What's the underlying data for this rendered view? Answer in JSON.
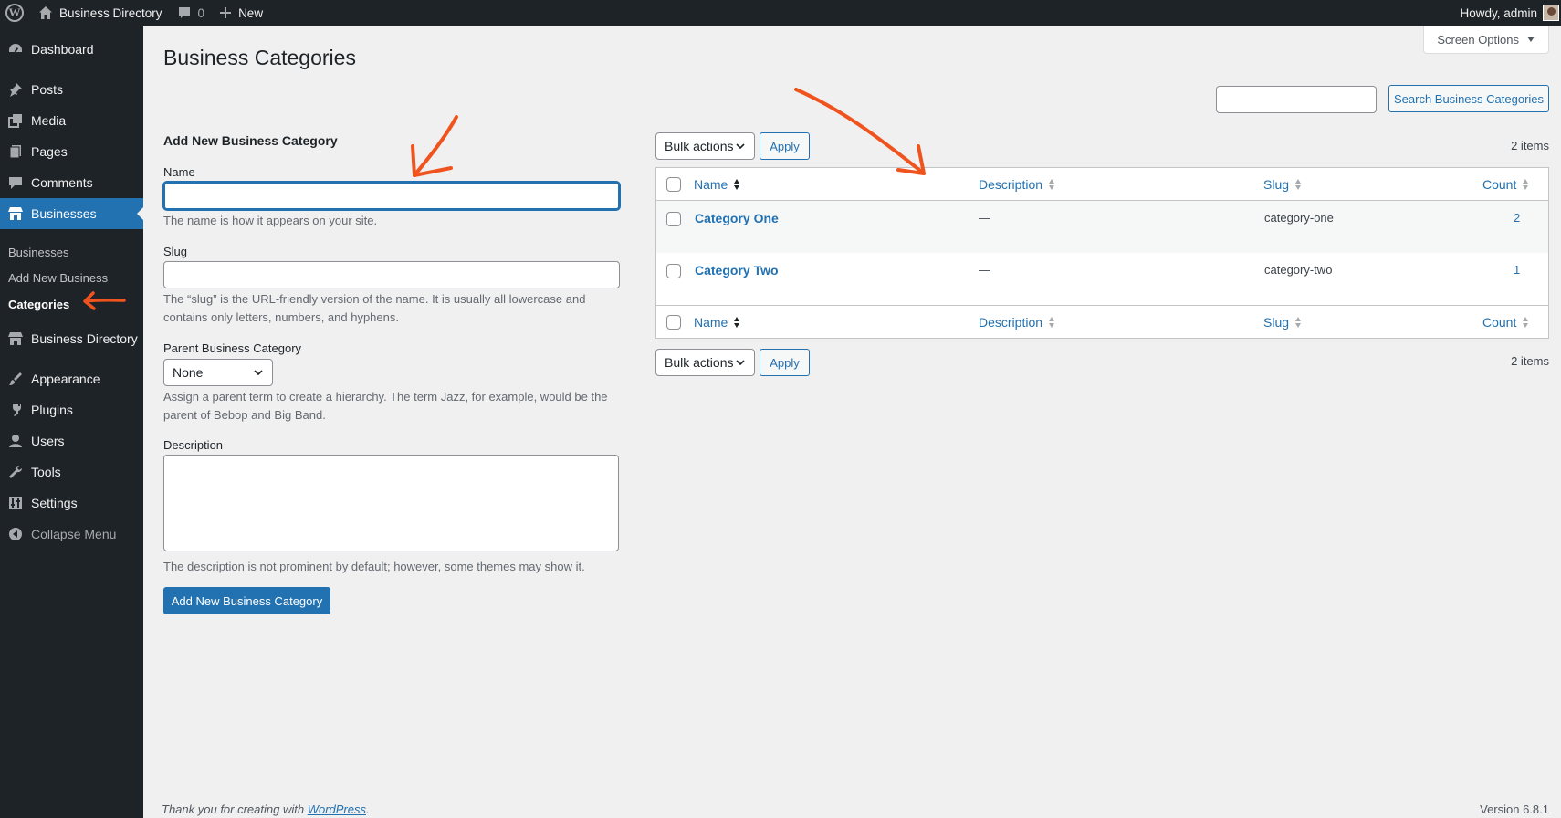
{
  "admin_bar": {
    "site_name": "Business Directory",
    "comments_count": "0",
    "new_label": "New",
    "howdy": "Howdy, admin"
  },
  "sidebar": {
    "items": [
      {
        "label": "Dashboard",
        "icon": "dashboard-icon"
      },
      {
        "label": "Posts",
        "icon": "pin-icon"
      },
      {
        "label": "Media",
        "icon": "media-icon"
      },
      {
        "label": "Pages",
        "icon": "pages-icon"
      },
      {
        "label": "Comments",
        "icon": "comment-icon"
      },
      {
        "label": "Businesses",
        "icon": "store-icon"
      },
      {
        "label": "Business Directory",
        "icon": "store-icon"
      },
      {
        "label": "Appearance",
        "icon": "brush-icon"
      },
      {
        "label": "Plugins",
        "icon": "plugin-icon"
      },
      {
        "label": "Users",
        "icon": "user-icon"
      },
      {
        "label": "Tools",
        "icon": "wrench-icon"
      },
      {
        "label": "Settings",
        "icon": "settings-icon"
      },
      {
        "label": "Collapse Menu",
        "icon": "collapse-icon"
      }
    ],
    "submenu": [
      {
        "label": "Businesses"
      },
      {
        "label": "Add New Business"
      },
      {
        "label": "Categories"
      }
    ]
  },
  "page": {
    "title": "Business Categories",
    "screen_options": "Screen Options",
    "search_button": "Search Business Categories"
  },
  "form": {
    "heading": "Add New Business Category",
    "name_label": "Name",
    "name_help": "The name is how it appears on your site.",
    "slug_label": "Slug",
    "slug_help": "The “slug” is the URL-friendly version of the name. It is usually all lowercase and contains only letters, numbers, and hyphens.",
    "parent_label": "Parent Business Category",
    "parent_value": "None",
    "parent_help": "Assign a parent term to create a hierarchy. The term Jazz, for example, would be the parent of Bebop and Big Band.",
    "description_label": "Description",
    "description_help": "The description is not prominent by default; however, some themes may show it.",
    "submit": "Add New Business Category"
  },
  "table": {
    "bulk_actions": "Bulk actions",
    "apply": "Apply",
    "items_count": "2 items",
    "columns": [
      "Name",
      "Description",
      "Slug",
      "Count"
    ],
    "rows": [
      {
        "name": "Category One",
        "description": "—",
        "slug": "category-one",
        "count": "2"
      },
      {
        "name": "Category Two",
        "description": "—",
        "slug": "category-two",
        "count": "1"
      }
    ]
  },
  "footer": {
    "thanks_prefix": "Thank you for creating with",
    "wordpress_link": "WordPress",
    "thanks_suffix": ".",
    "version": "Version 6.8.1"
  },
  "colors": {
    "admin_dark": "#1d2327",
    "accent": "#2271b1",
    "annotation": "#f0541e"
  }
}
